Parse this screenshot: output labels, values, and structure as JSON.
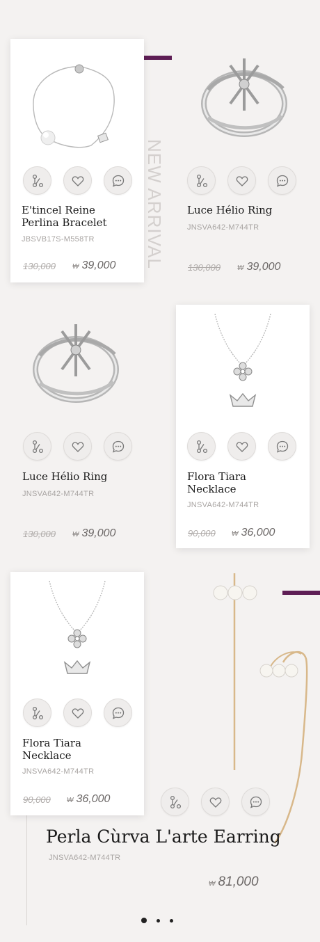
{
  "section_label": "NEW ARRIVAL",
  "products": [
    {
      "name_line1": "E'tincel Reine",
      "name_line2": "Perlina Bracelet",
      "code": "JBSVB17S-M558TR",
      "old_price": "130,000",
      "currency": "₩",
      "price": "39,000"
    },
    {
      "name_line1": "Luce Hélio Ring",
      "name_line2": "",
      "code": "JNSVA642-M744TR",
      "old_price": "130,000",
      "currency": "₩",
      "price": "39,000"
    },
    {
      "name_line1": "Luce Hélio Ring",
      "name_line2": "",
      "code": "JNSVA642-M744TR",
      "old_price": "130,000",
      "currency": "₩",
      "price": "39,000"
    },
    {
      "name_line1": "Flora Tiara",
      "name_line2": "Necklace",
      "code": "JNSVA642-M744TR",
      "old_price": "90,000",
      "currency": "₩",
      "price": "36,000"
    },
    {
      "name_line1": "Flora Tiara",
      "name_line2": "Necklace",
      "code": "JNSVA642-M744TR",
      "old_price": "90,000",
      "currency": "₩",
      "price": "36,000"
    },
    {
      "name_line1": "Perla Cùrva L'arte Earring",
      "name_line2": "",
      "code": "JNSVA642-M744TR",
      "old_price": "",
      "currency": "₩",
      "price": "81,000"
    }
  ],
  "action_icons": [
    "share-icon",
    "heart-icon",
    "chat-icon"
  ],
  "pagination": {
    "total": 3,
    "active": 0
  },
  "colors": {
    "accent": "#5e1e55",
    "background": "#f4f2f1",
    "card": "#ffffff",
    "price": "#6b6766"
  }
}
